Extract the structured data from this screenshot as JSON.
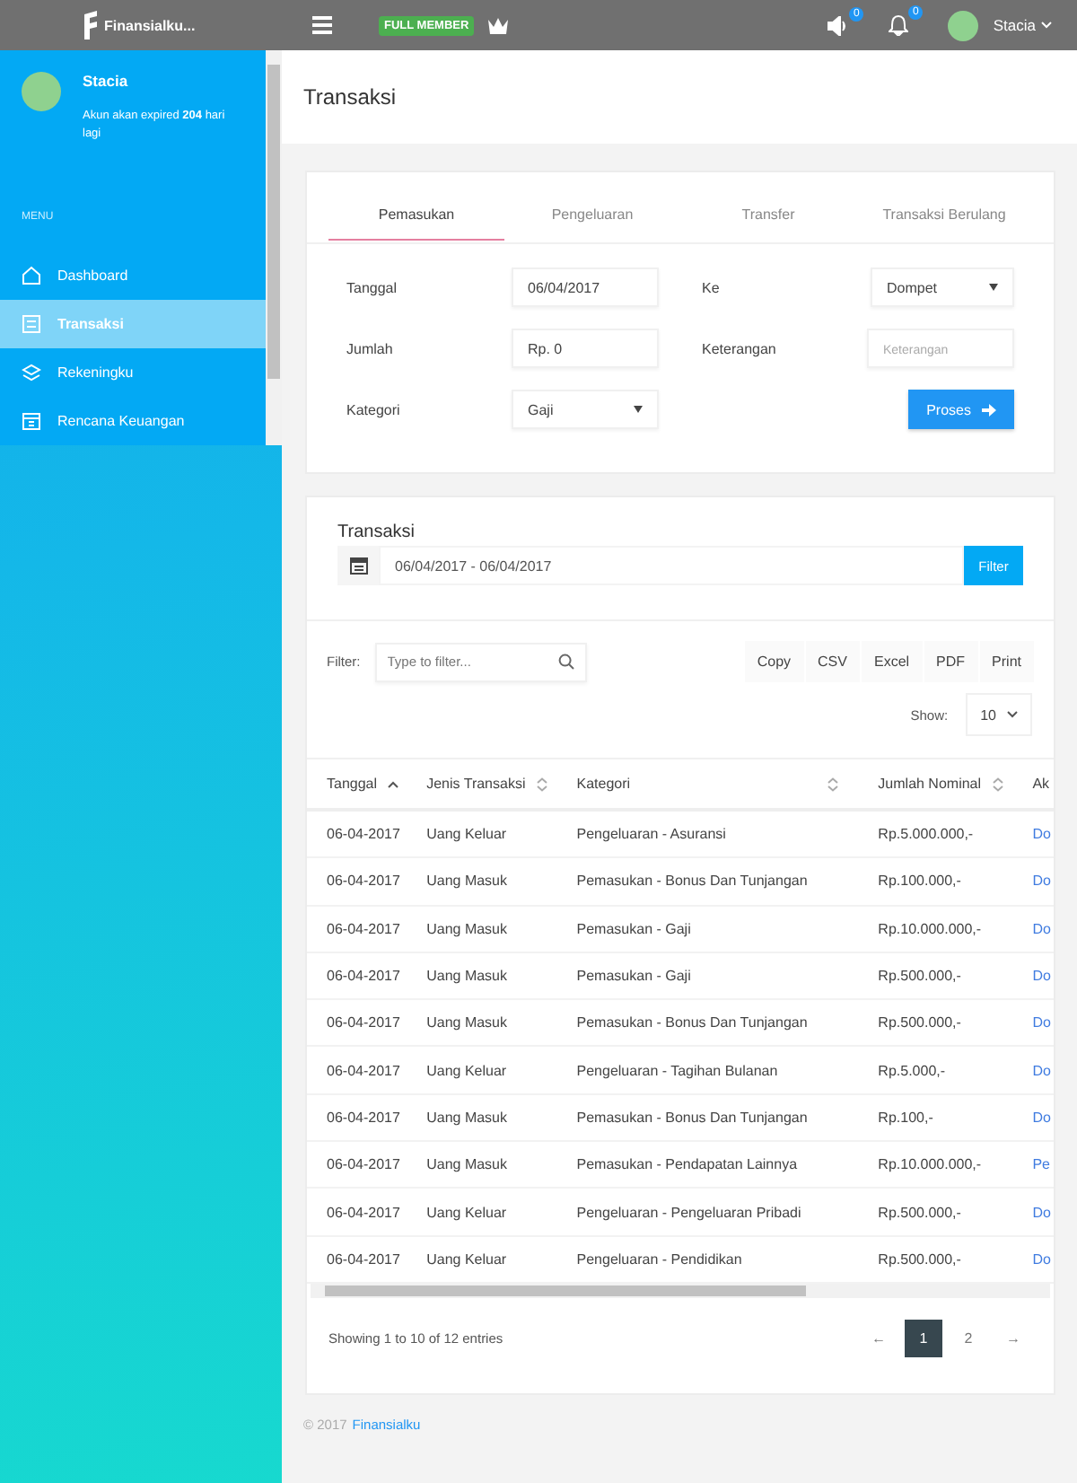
{
  "topbar": {
    "logo": "Finansialku...",
    "badge": "FULL MEMBER",
    "notifications": [
      {
        "kind": "sound",
        "count": "0"
      },
      {
        "kind": "bell",
        "count": "0"
      }
    ],
    "user": "Stacia"
  },
  "sidebar": {
    "user": "Stacia",
    "note": "Akun akan expired **204** hari lagi",
    "section": "MENU",
    "items": [
      {
        "label": "Dashboard",
        "selected": false
      },
      {
        "label": "Transaksi",
        "selected": true
      },
      {
        "label": "Rekeningku",
        "selected": false
      },
      {
        "label": "Rencana Keuangan",
        "selected": false
      }
    ]
  },
  "page_title": "Transaksi",
  "form": {
    "tabs": [
      {
        "label": "Pemasukan",
        "selected": true
      },
      {
        "label": "Pengeluaran",
        "selected": false
      },
      {
        "label": "Transfer",
        "selected": false
      },
      {
        "label": "Transaksi Berulang",
        "selected": false
      }
    ],
    "fields": [
      {
        "label": "Tanggal",
        "kind": "input",
        "value": "06/04/2017"
      },
      {
        "label": "Ke",
        "kind": "select",
        "value": "Dompet"
      },
      {
        "label": "Jumlah",
        "kind": "input",
        "value": "Rp. 0"
      },
      {
        "label": "Keterangan",
        "kind": "input",
        "placeholder": "Keterangan"
      },
      {
        "label": "Kategori",
        "kind": "select",
        "value": "Gaji"
      }
    ],
    "submit": "Proses"
  },
  "transactions": {
    "title": "Transaksi",
    "date_range": "06/04/2017 - 06/04/2017",
    "filter_button": "Filter",
    "filter_label": "Filter:",
    "filter_placeholder": "Type to filter...",
    "exports": [
      "Copy",
      "CSV",
      "Excel",
      "PDF",
      "Print"
    ],
    "show_label": "Show:",
    "show_value": "10",
    "columns": [
      {
        "label": "Tanggal",
        "sorted": true
      },
      {
        "label": "Jenis Transaksi",
        "sorted": false
      },
      {
        "label": "Kategori",
        "sorted": false
      },
      {
        "label": "Jumlah Nominal",
        "sorted": false
      },
      {
        "label": "Ak"
      }
    ],
    "rows": [
      [
        "06-04-2017",
        "Uang Keluar",
        "Pengeluaran - Asuransi",
        "Rp.5.000.000,-",
        "Do"
      ],
      [
        "06-04-2017",
        "Uang Masuk",
        "Pemasukan - Bonus Dan Tunjangan",
        "Rp.100.000,-",
        "Do"
      ],
      [
        "06-04-2017",
        "Uang Masuk",
        "Pemasukan - Gaji",
        "Rp.10.000.000,-",
        "Do"
      ],
      [
        "06-04-2017",
        "Uang Masuk",
        "Pemasukan - Gaji",
        "Rp.500.000,-",
        "Do"
      ],
      [
        "06-04-2017",
        "Uang Masuk",
        "Pemasukan - Bonus Dan Tunjangan",
        "Rp.500.000,-",
        "Do"
      ],
      [
        "06-04-2017",
        "Uang Keluar",
        "Pengeluaran - Tagihan Bulanan",
        "Rp.5.000,-",
        "Do"
      ],
      [
        "06-04-2017",
        "Uang Masuk",
        "Pemasukan - Bonus Dan Tunjangan",
        "Rp.100,-",
        "Do"
      ],
      [
        "06-04-2017",
        "Uang Masuk",
        "Pemasukan - Pendapatan Lainnya",
        "Rp.10.000.000,-",
        "Pe"
      ],
      [
        "06-04-2017",
        "Uang Keluar",
        "Pengeluaran - Pengeluaran Pribadi",
        "Rp.500.000,-",
        "Do"
      ],
      [
        "06-04-2017",
        "Uang Keluar",
        "Pengeluaran - Pendidikan",
        "Rp.500.000,-",
        "Do"
      ]
    ],
    "info": "Showing 1 to 10 of 12 entries",
    "pages": [
      {
        "label": "←",
        "selected": false
      },
      {
        "label": "1",
        "selected": true
      },
      {
        "label": "2",
        "selected": false
      },
      {
        "label": "→",
        "selected": false
      }
    ]
  },
  "footer": {
    "copyright": "© 2017",
    "link": "Finansialku"
  }
}
